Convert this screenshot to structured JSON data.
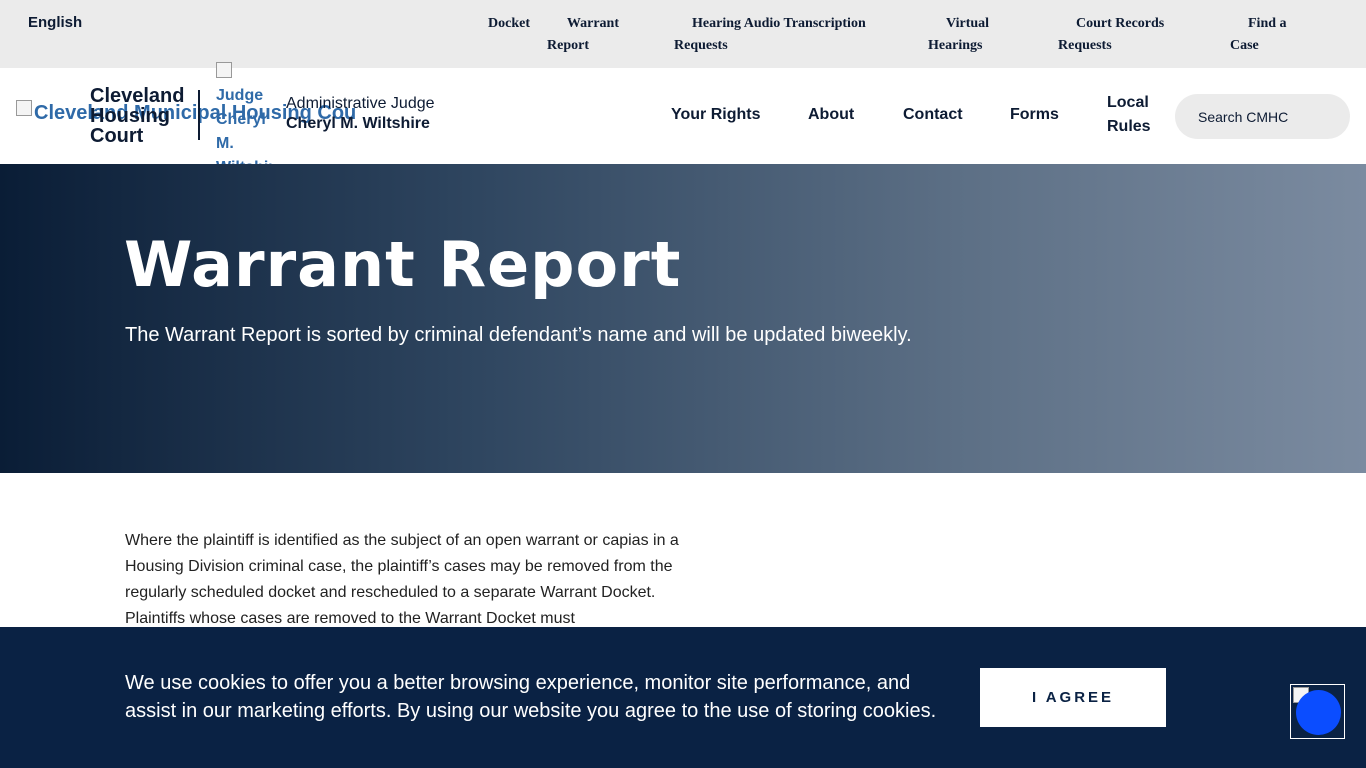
{
  "topbar": {
    "language": "English",
    "links": [
      {
        "line1": "Docket",
        "line2": ""
      },
      {
        "line1": "Warrant",
        "line2": "Report"
      },
      {
        "line1": "Hearing Audio Transcription",
        "line2": "Requests"
      },
      {
        "line1": "Virtual",
        "line2": "Hearings"
      },
      {
        "line1": "Court Records",
        "line2": "Requests"
      },
      {
        "line1": "Find a",
        "line2": "Case"
      }
    ]
  },
  "header": {
    "logo_alt": "Cleveland Municipal Housing Cou",
    "site_name": [
      "Cleveland",
      "Housing",
      "Court"
    ],
    "judge_img_alt": "Judge Cheryl M. Wiltshire",
    "judge_role": "Administrative Judge",
    "judge_name": "Cheryl M. Wiltshire",
    "nav": [
      {
        "label": "Your Rights"
      },
      {
        "label": "About"
      },
      {
        "label": "Contact"
      },
      {
        "label": "Forms"
      },
      {
        "label": "Local Rules"
      }
    ],
    "search_placeholder": "Search CMHC"
  },
  "hero": {
    "title": "Warrant Report",
    "subtitle": "The Warrant Report is sorted by criminal defendant’s name and will be updated biweekly."
  },
  "main": {
    "paragraph": "Where the plaintiff is identified as the subject of an open warrant or capias in a Housing Division criminal case, the plaintiff’s cases may be removed from the regularly scheduled docket and rescheduled to a separate Warrant Docket. Plaintiffs whose cases are removed to the Warrant Docket must"
  },
  "cookie": {
    "text": "We use cookies to offer you a better browsing experience, monitor site performance, and assist in our marketing efforts. By using our website you agree to the use of storing cookies.",
    "button": "I AGREE"
  },
  "colors": {
    "navy": "#0d1b33",
    "banner": "#0a2244",
    "accessibility_button": "#0b4dff"
  }
}
